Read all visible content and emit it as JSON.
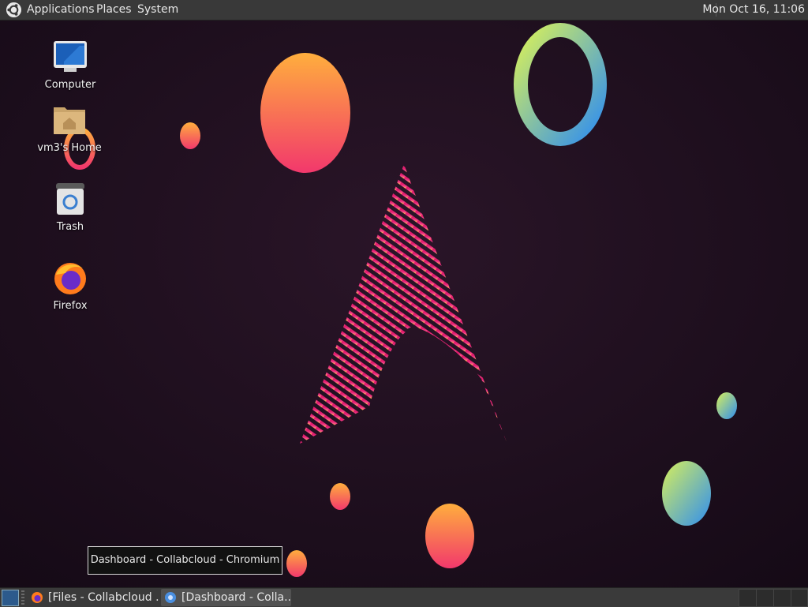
{
  "top_panel": {
    "menus": [
      "Applications",
      "Places",
      "System"
    ],
    "clock": "Mon Oct 16, 11:06",
    "logo_icon": "ubuntu-logo-icon"
  },
  "desktop": {
    "icons": [
      {
        "label": "Computer",
        "icon": "computer-icon"
      },
      {
        "label": "vm3's Home",
        "icon": "home-folder-icon"
      },
      {
        "label": "Trash",
        "icon": "trash-icon"
      },
      {
        "label": "Firefox",
        "icon": "firefox-icon"
      }
    ]
  },
  "tooltip": "Dashboard - Collabcloud - Chromium",
  "taskbar": {
    "tasks": [
      {
        "label": "[Files - Collabcloud ...",
        "icon": "firefox-icon",
        "active": false
      },
      {
        "label": "[Dashboard - Colla...",
        "icon": "chromium-icon",
        "active": true
      }
    ],
    "workspaces": 4
  },
  "colors": {
    "panel": "#393939",
    "wallpaper": "#1e0f1f",
    "accent_pink": "#e6206e",
    "accent_orange": "#ff9a3c"
  }
}
